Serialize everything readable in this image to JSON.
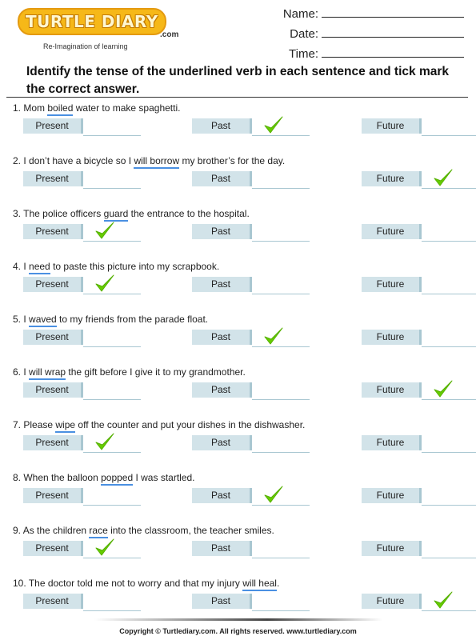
{
  "logo": {
    "word": "TURTLE DIARY",
    "suffix": ".com",
    "tagline": "Re-Imagination of learning"
  },
  "fields": [
    {
      "label": "Name:"
    },
    {
      "label": "Date:"
    },
    {
      "label": "Time:"
    }
  ],
  "instructions": "Identify the tense of the underlined verb in each sentence and tick mark the correct answer.",
  "option_labels": [
    "Present",
    "Past",
    "Future"
  ],
  "colors": {
    "option_bg": "#d2e3e9",
    "option_accent": "#a9c7d1",
    "underline": "#4a90e2",
    "tick": "#66cc00"
  },
  "questions": [
    {
      "num": "1.",
      "before": "Mom ",
      "verb": "boiled",
      "after": " water to make spaghetti.",
      "answer": "Past"
    },
    {
      "num": "2.",
      "before": "I don’t have a bicycle so I ",
      "verb": "will borrow",
      "after": " my brother’s for the day.",
      "answer": "Future"
    },
    {
      "num": "3.",
      "before": "The police officers ",
      "verb": "guard",
      "after": " the entrance to the hospital.",
      "answer": "Present"
    },
    {
      "num": "4.",
      "before": "I ",
      "verb": "need",
      "after": " to paste this picture into my scrapbook.",
      "answer": "Present"
    },
    {
      "num": "5.",
      "before": "I ",
      "verb": "waved",
      "after": " to my friends from the parade float.",
      "answer": "Past"
    },
    {
      "num": "6.",
      "before": "I ",
      "verb": "will wrap",
      "after": " the gift before I give it to my grandmother.",
      "answer": "Future"
    },
    {
      "num": "7.",
      "before": "Please ",
      "verb": "wipe",
      "after": " off the counter and put your dishes in the dishwasher.",
      "answer": "Present"
    },
    {
      "num": "8.",
      "before": "When the balloon ",
      "verb": "popped",
      "after": " I was startled.",
      "answer": "Past"
    },
    {
      "num": "9.",
      "before": "As the children ",
      "verb": "race",
      "after": " into the classroom, the teacher smiles.",
      "answer": "Present"
    },
    {
      "num": "10.",
      "before": "The doctor told me not to worry and that my injury ",
      "verb": "will heal",
      "after": ".",
      "answer": "Future"
    }
  ],
  "footer": "Copyright © Turtlediary.com. All rights reserved. www.turtlediary.com"
}
